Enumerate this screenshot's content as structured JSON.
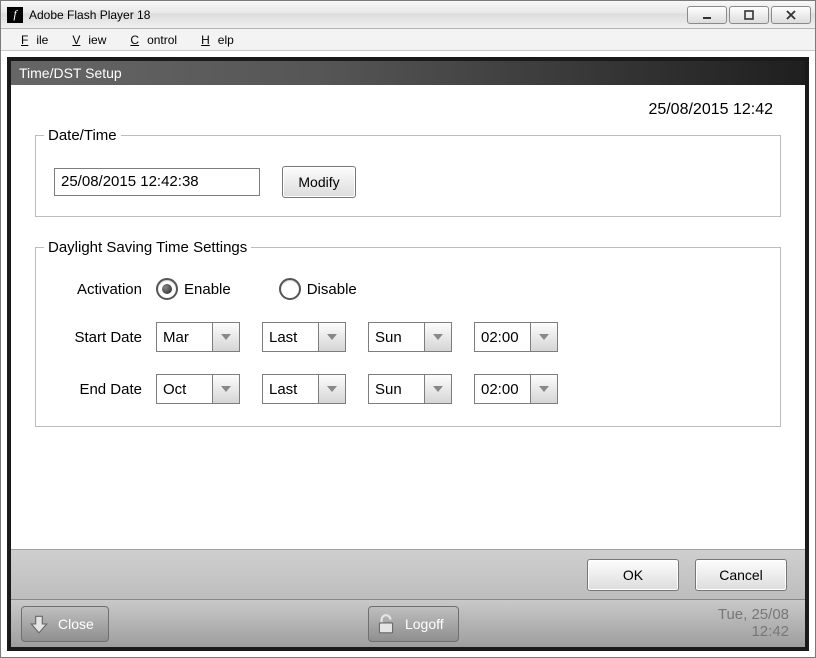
{
  "window": {
    "title": "Adobe Flash Player 18",
    "menus": {
      "file": "File",
      "view": "View",
      "control": "Control",
      "help": "Help"
    }
  },
  "panel": {
    "title": "Time/DST Setup"
  },
  "header_clock": "25/08/2015 12:42",
  "datetime": {
    "legend": "Date/Time",
    "value": "25/08/2015 12:42:38",
    "modify_label": "Modify"
  },
  "dst": {
    "legend": "Daylight Saving Time Settings",
    "activation_label": "Activation",
    "enable_label": "Enable",
    "disable_label": "Disable",
    "selected": "enable",
    "start_label": "Start Date",
    "end_label": "End Date",
    "start": {
      "month": "Mar",
      "week": "Last",
      "day": "Sun",
      "time": "02:00"
    },
    "end": {
      "month": "Oct",
      "week": "Last",
      "day": "Sun",
      "time": "02:00"
    }
  },
  "footer": {
    "ok": "OK",
    "cancel": "Cancel"
  },
  "status": {
    "close": "Close",
    "logoff": "Logoff",
    "date": "Tue, 25/08",
    "time": "12:42"
  }
}
